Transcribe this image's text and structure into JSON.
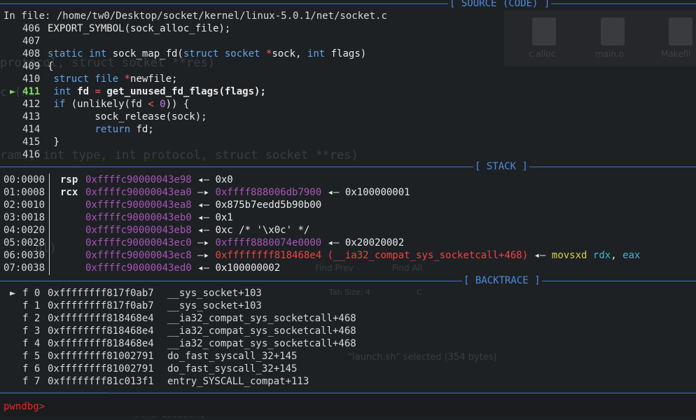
{
  "source": {
    "file_line": "In file: /home/tw0/Desktop/socket/kernel/linux-5.0.1/net/socket.c",
    "title": "[ SOURCE (CODE) ]",
    "lines": [
      {
        "no": "406",
        "parts": [
          {
            "t": "EXPORT_SYMBOL(sock_alloc_file);",
            "c": "n"
          }
        ]
      },
      {
        "no": "407",
        "parts": []
      },
      {
        "no": "408",
        "parts": [
          {
            "t": "static int ",
            "c": "k"
          },
          {
            "t": "sock_map_fd(",
            "c": "n"
          },
          {
            "t": "struct socket ",
            "c": "k"
          },
          {
            "t": "*",
            "c": "op"
          },
          {
            "t": "sock, ",
            "c": "n"
          },
          {
            "t": "int ",
            "c": "k"
          },
          {
            "t": "flags)",
            "c": "n"
          }
        ]
      },
      {
        "no": "409",
        "parts": [
          {
            "t": "{",
            "c": "n"
          }
        ]
      },
      {
        "no": "410",
        "parts": [
          {
            "t": " struct file ",
            "c": "k"
          },
          {
            "t": "*",
            "c": "op"
          },
          {
            "t": "newfile;",
            "c": "n"
          }
        ]
      },
      {
        "no": "411",
        "current": true,
        "parts": [
          {
            "t": " int ",
            "c": "k"
          },
          {
            "t": "fd ",
            "c": "b"
          },
          {
            "t": "= ",
            "c": "op"
          },
          {
            "t": "get_unused_fd_flags(flags);",
            "c": "b"
          }
        ]
      },
      {
        "no": "412",
        "parts": [
          {
            "t": " if ",
            "c": "k"
          },
          {
            "t": "(unlikely(fd ",
            "c": "n"
          },
          {
            "t": "< ",
            "c": "op"
          },
          {
            "t": "0",
            "c": "num"
          },
          {
            "t": ")) {",
            "c": "n"
          }
        ]
      },
      {
        "no": "413",
        "parts": [
          {
            "t": "        sock_release(sock);",
            "c": "n"
          }
        ]
      },
      {
        "no": "414",
        "parts": [
          {
            "t": "        return ",
            "c": "k"
          },
          {
            "t": "fd;",
            "c": "n"
          }
        ]
      },
      {
        "no": "415",
        "parts": [
          {
            "t": " }",
            "c": "n"
          }
        ]
      },
      {
        "no": "416",
        "parts": []
      }
    ]
  },
  "stack": {
    "title": "[ STACK ]",
    "rows": [
      {
        "off": "00:0000",
        "reg": "rsp",
        "parts": [
          {
            "t": "0xffffc90000043e98",
            "c": "addr"
          },
          {
            "t": " ◂— ",
            "c": "n"
          },
          {
            "t": "0x0",
            "c": "n"
          }
        ]
      },
      {
        "off": "01:0008",
        "reg": "rcx",
        "parts": [
          {
            "t": "0xffffc90000043ea0",
            "c": "addr"
          },
          {
            "t": " —▸ ",
            "c": "n"
          },
          {
            "t": "0xffff888006db7900",
            "c": "heap"
          },
          {
            "t": " ◂— ",
            "c": "n"
          },
          {
            "t": "0x100000001",
            "c": "n"
          }
        ]
      },
      {
        "off": "02:0010",
        "reg": "",
        "parts": [
          {
            "t": "0xffffc90000043ea8",
            "c": "addr"
          },
          {
            "t": " ◂— ",
            "c": "n"
          },
          {
            "t": "0x875b7eedd5b90b00",
            "c": "n"
          }
        ]
      },
      {
        "off": "03:0018",
        "reg": "",
        "parts": [
          {
            "t": "0xffffc90000043eb0",
            "c": "addr"
          },
          {
            "t": " ◂— ",
            "c": "n"
          },
          {
            "t": "0x1",
            "c": "n"
          }
        ]
      },
      {
        "off": "04:0020",
        "reg": "",
        "parts": [
          {
            "t": "0xffffc90000043eb8",
            "c": "addr"
          },
          {
            "t": " ◂— ",
            "c": "n"
          },
          {
            "t": "0xc /* '\\x0c' */",
            "c": "n"
          }
        ]
      },
      {
        "off": "05:0028",
        "reg": "",
        "parts": [
          {
            "t": "0xffffc90000043ec0",
            "c": "addr"
          },
          {
            "t": " —▸ ",
            "c": "n"
          },
          {
            "t": "0xffff8880074e0000",
            "c": "heap"
          },
          {
            "t": " ◂— ",
            "c": "n"
          },
          {
            "t": "0x20020002",
            "c": "n"
          }
        ]
      },
      {
        "off": "06:0030",
        "reg": "",
        "parts": [
          {
            "t": "0xffffc90000043ec8",
            "c": "addr"
          },
          {
            "t": " —▸ ",
            "c": "n"
          },
          {
            "t": "0xffffffff818468e4 (__ia32_compat_sys_socketcall+468)",
            "c": "code"
          },
          {
            "t": " ◂— ",
            "c": "n"
          },
          {
            "t": "movsxd ",
            "c": "yel"
          },
          {
            "t": "rdx",
            "c": "cyan"
          },
          {
            "t": ", ",
            "c": "n"
          },
          {
            "t": "eax",
            "c": "cyan"
          }
        ]
      },
      {
        "off": "07:0038",
        "reg": "",
        "parts": [
          {
            "t": "0xffffc90000043ed0",
            "c": "addr"
          },
          {
            "t": " ◂— ",
            "c": "n"
          },
          {
            "t": "0x100000002",
            "c": "n"
          }
        ]
      }
    ]
  },
  "backtrace": {
    "title": "[ BACKTRACE ]",
    "frames": [
      {
        "label": "f 0",
        "addr": "0xffffffff817f0ab7",
        "sym": "__sys_socket+103",
        "current": true
      },
      {
        "label": "f 1",
        "addr": "0xffffffff817f0ab7",
        "sym": "__sys_socket+103"
      },
      {
        "label": "f 2",
        "addr": "0xffffffff818468e4",
        "sym": "__ia32_compat_sys_socketcall+468"
      },
      {
        "label": "f 3",
        "addr": "0xffffffff818468e4",
        "sym": "__ia32_compat_sys_socketcall+468"
      },
      {
        "label": "f 4",
        "addr": "0xffffffff818468e4",
        "sym": "__ia32_compat_sys_socketcall+468"
      },
      {
        "label": "f 5",
        "addr": "0xffffffff81002791",
        "sym": "do_fast_syscall_32+145"
      },
      {
        "label": "f 6",
        "addr": "0xffffffff81002791",
        "sym": "do_fast_syscall_32+145"
      },
      {
        "label": "f 7",
        "addr": "0xffffffff81c013f1",
        "sym": "entry_SYSCALL_compat+113"
      }
    ]
  },
  "prompt": "pwndbg>",
  "arrow_glyph": "►",
  "ghost": {
    "files": [
      "c.alloc",
      "main.o",
      "Makefil"
    ],
    "find_prev": "Find Prev",
    "find_all": "Find All",
    "tab_size": "Tab Size: 4",
    "lang": "C",
    "selected": "\"launch.sh\" selected  (354 bytes)",
    "other_locations": "Other Locations",
    "code1": "protocol, struct socket **res)",
    "code2": "c (ns",
    "code3": "rams, int type, int protocol, struct socket **res)",
    "code4": "ol)"
  },
  "colors": {
    "accent": "#3b73c7",
    "current": "#7fd962",
    "prompt": "#e62626",
    "address": "#a855b6"
  }
}
